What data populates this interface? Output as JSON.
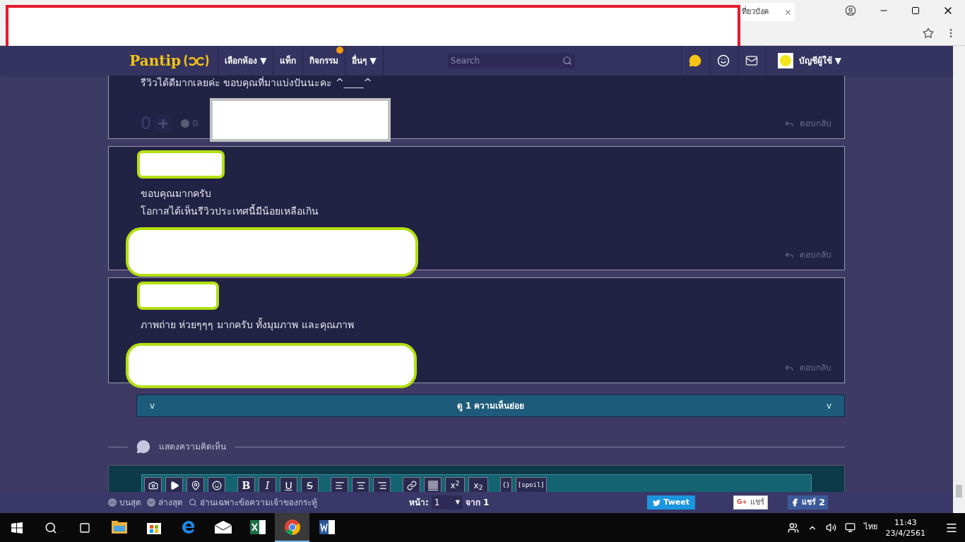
{
  "browser": {
    "tab_title": "ที่ยวบังค"
  },
  "navbar": {
    "logo": "Pantip",
    "menu": [
      {
        "label": "เลือกห้อง ▼",
        "badge": false
      },
      {
        "label": "แท็ก",
        "badge": false
      },
      {
        "label": "กิจกรรม",
        "badge": true
      },
      {
        "label": "อื่นๆ ▼",
        "badge": false
      }
    ],
    "search": {
      "placeholder": "Search"
    },
    "account": "บัญชีผู้ใช้ ▼"
  },
  "comments": [
    {
      "kind": "cut",
      "lines": [
        "รีวิวได้ดีมากเลยค่ะ ขอบคุณที่มาแบ่งปันนะคะ ^____^"
      ],
      "votes": "0",
      "emotions": "0",
      "reply": "ตอบกลับ"
    },
    {
      "kind": "full",
      "lines": [
        "ขอบคุณมากครับ",
        "โอกาสได้เห็นรีวิวประเทศนี้มีน้อยเหลือเกิน"
      ],
      "reply": "ตอบกลับ"
    },
    {
      "kind": "full",
      "lines": [
        "ภาพถ่าย ห่วยๆๆๆ มากครับ ทั้งมุมภาพ และคุณภาพ"
      ],
      "reply": "ตอบกลับ"
    }
  ],
  "subcomments": {
    "left": "v",
    "label": "ดู 1 ความเห็นย่อย",
    "right": "v"
  },
  "compose": {
    "heading": "แสดงความคิดเห็น",
    "toolbar": [
      "B",
      "I",
      "U",
      "S",
      "{}",
      "[spoil]"
    ],
    "scripts": [
      "x$^{2}$",
      "x$_{2}$"
    ]
  },
  "bottom_bar": {
    "top": "บนสุด",
    "bottom": "ล่างสุด",
    "owner_only": "อ่านเฉพาะข้อความเจ้าของกระทู้",
    "page_label": "หน้า:",
    "page": "1",
    "page_caret": "▼",
    "of": "จาก 1",
    "tweet": "Tweet",
    "gplus_mark": "G+",
    "gplus": "แชร์",
    "fb": "แชร์",
    "fb_count": "2"
  },
  "taskbar": {
    "apps": [
      {
        "kind": "folder",
        "selected": false
      },
      {
        "kind": "store",
        "selected": false
      },
      {
        "kind": "edge",
        "selected": false
      },
      {
        "kind": "mail",
        "selected": false
      },
      {
        "kind": "excel",
        "selected": false
      },
      {
        "kind": "chrome",
        "selected": true
      },
      {
        "kind": "word",
        "selected": false
      }
    ],
    "lang": "ไทย",
    "time": "11:43",
    "date": "23/4/2561"
  }
}
